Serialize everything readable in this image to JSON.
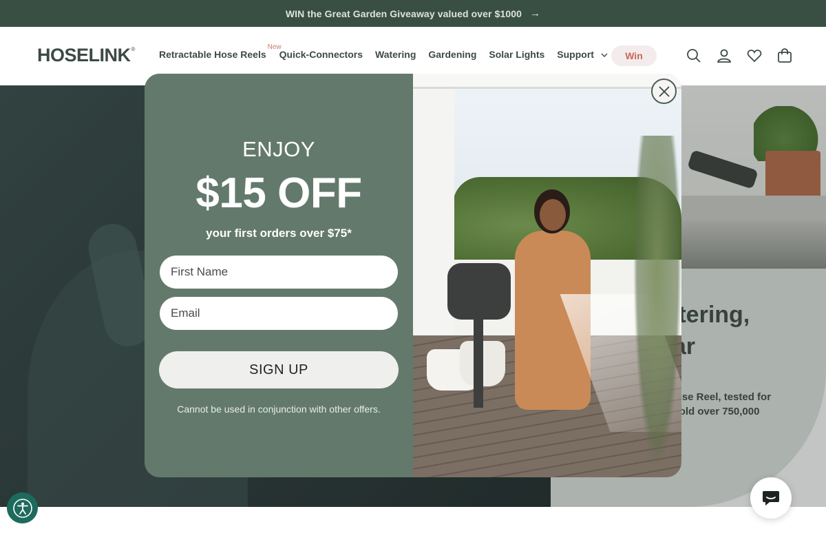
{
  "announcement": {
    "text": "WIN the Great Garden Giveaway valued over $1000",
    "arrow": "→"
  },
  "header": {
    "logo": "HOSELINK",
    "logo_mark": "®",
    "nav": [
      {
        "label": "Retractable Hose Reels",
        "badge": "New"
      },
      {
        "label": "Quick-Connectors"
      },
      {
        "label": "Watering"
      },
      {
        "label": "Gardening"
      },
      {
        "label": "Solar Lights"
      },
      {
        "label": "Support",
        "dropdown": true
      }
    ],
    "win_label": "Win",
    "icons": [
      "search-icon",
      "account-icon",
      "wishlist-heart-icon",
      "cart-bag-icon"
    ]
  },
  "hero": {
    "heading_line1": "watering,",
    "heading_line2": "year",
    "body_line1": "den Hose Reel, tested for",
    "body_line2": ", has sold over 750,000"
  },
  "popup": {
    "enjoy": "ENJOY",
    "offer": "$15 OFF",
    "subline": "your first orders over $75*",
    "first_name_placeholder": "First Name",
    "email_placeholder": "Email",
    "signup_label": "SIGN UP",
    "disclaimer": "Cannot be used in conjunction with other offers."
  },
  "colors": {
    "announcement_bg": "#3a4f44",
    "popup_bg": "#63796c",
    "win_pill_bg": "#f4ecec",
    "win_text": "#c9655c",
    "accessibility_bg": "#1e6a5d"
  }
}
